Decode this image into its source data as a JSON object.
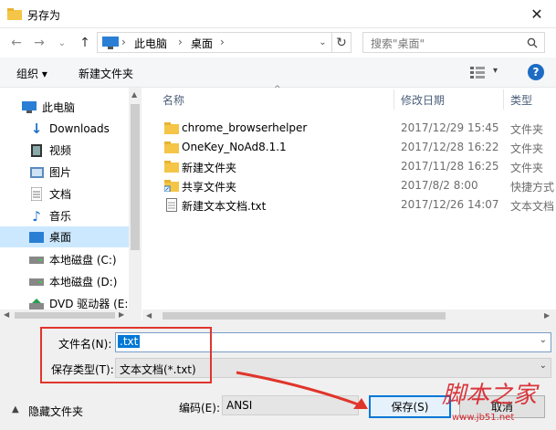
{
  "window": {
    "title": "另存为",
    "close_glyph": "✕"
  },
  "address": {
    "path": [
      "此电脑",
      "桌面"
    ],
    "sep": "›"
  },
  "search": {
    "placeholder": "搜索\"桌面\""
  },
  "toolbar": {
    "organize": "组织 ▾",
    "new_folder": "新建文件夹"
  },
  "sidebar": {
    "items": [
      {
        "label": "此电脑",
        "icon": "computer-icon"
      },
      {
        "label": "Downloads",
        "icon": "downloads-icon"
      },
      {
        "label": "视频",
        "icon": "video-icon"
      },
      {
        "label": "图片",
        "icon": "pictures-icon"
      },
      {
        "label": "文档",
        "icon": "documents-icon"
      },
      {
        "label": "音乐",
        "icon": "music-icon"
      },
      {
        "label": "桌面",
        "icon": "desktop-icon"
      },
      {
        "label": "本地磁盘 (C:)",
        "icon": "drive-icon"
      },
      {
        "label": "本地磁盘 (D:)",
        "icon": "drive-icon"
      },
      {
        "label": "DVD 驱动器 (E:)",
        "icon": "dvd-icon"
      }
    ]
  },
  "columns": {
    "name": "名称",
    "modified": "修改日期",
    "type": "类型"
  },
  "files": [
    {
      "name": "chrome_browserhelper",
      "date": "2017/12/29 15:45",
      "type": "文件夹",
      "icon": "folder-icon"
    },
    {
      "name": "OneKey_NoAd8.1.1",
      "date": "2017/12/28 16:22",
      "type": "文件夹",
      "icon": "folder-icon"
    },
    {
      "name": "新建文件夹",
      "date": "2017/11/28 16:25",
      "type": "文件夹",
      "icon": "folder-icon"
    },
    {
      "name": "共享文件夹",
      "date": "2017/8/2 8:00",
      "type": "快捷方式",
      "icon": "shortcut-icon"
    },
    {
      "name": "新建文本文档.txt",
      "date": "2017/12/26 14:07",
      "type": "文本文档",
      "icon": "text-file-icon"
    }
  ],
  "form": {
    "filename_label": "文件名(N):",
    "filename_value": ".txt",
    "filetype_label": "保存类型(T):",
    "filetype_value": "文本文档(*.txt)",
    "encoding_label": "编码(E):",
    "encoding_value": "ANSI",
    "hide_folders": "隐藏文件夹",
    "save": "保存(S)",
    "cancel": "取消"
  },
  "watermark": {
    "text": "脚本之家",
    "sub": "www.jb51.net"
  },
  "colors": {
    "accent": "#0078d7",
    "annotation": "#e0352b"
  }
}
